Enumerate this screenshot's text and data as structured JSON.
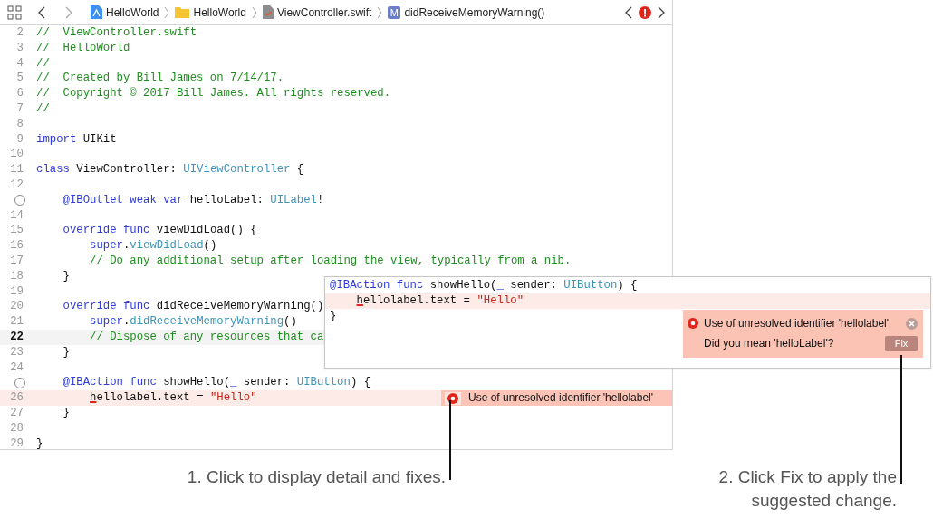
{
  "breadcrumbs": [
    {
      "kind": "app",
      "label": "HelloWorld"
    },
    {
      "kind": "folder",
      "label": "HelloWorld"
    },
    {
      "kind": "file",
      "label": "ViewController.swift"
    },
    {
      "kind": "method",
      "badge": "M",
      "label": "didReceiveMemoryWarning()"
    }
  ],
  "editor": {
    "lines": [
      {
        "number": "2",
        "connection": false,
        "current": false,
        "error": false,
        "code": [
          {
            "kind": "comment",
            "text": "//  ViewController.swift"
          }
        ]
      },
      {
        "number": "3",
        "connection": false,
        "current": false,
        "error": false,
        "code": [
          {
            "kind": "comment",
            "text": "//  HelloWorld"
          }
        ]
      },
      {
        "number": "4",
        "connection": false,
        "current": false,
        "error": false,
        "code": [
          {
            "kind": "comment",
            "text": "//"
          }
        ]
      },
      {
        "number": "5",
        "connection": false,
        "current": false,
        "error": false,
        "code": [
          {
            "kind": "comment",
            "text": "//  Created by Bill James on 7/14/17."
          }
        ]
      },
      {
        "number": "6",
        "connection": false,
        "current": false,
        "error": false,
        "code": [
          {
            "kind": "comment",
            "text": "//  Copyright © 2017 Bill James. All rights reserved."
          }
        ]
      },
      {
        "number": "7",
        "connection": false,
        "current": false,
        "error": false,
        "code": [
          {
            "kind": "comment",
            "text": "//"
          }
        ]
      },
      {
        "number": "8",
        "connection": false,
        "current": false,
        "error": false
      },
      {
        "number": "9",
        "connection": false,
        "current": false,
        "error": false,
        "code": [
          {
            "kind": "kw",
            "text": "import"
          },
          {
            "kind": "plain",
            "text": " UIKit"
          }
        ]
      },
      {
        "number": "10",
        "connection": false,
        "current": false,
        "error": false
      },
      {
        "number": "11",
        "connection": false,
        "current": false,
        "error": false,
        "code": [
          {
            "kind": "kw",
            "text": "class"
          },
          {
            "kind": "plain",
            "text": " ViewController: "
          },
          {
            "kind": "type",
            "text": "UIViewController"
          },
          {
            "kind": "plain",
            "text": " {"
          }
        ]
      },
      {
        "number": "12",
        "connection": false,
        "current": false,
        "error": false
      },
      {
        "connection": true,
        "current": false,
        "error": false,
        "code": [
          {
            "kind": "kw",
            "text": "    @IBOutlet weak var"
          },
          {
            "kind": "plain",
            "text": " helloLabel: "
          },
          {
            "kind": "type",
            "text": "UILabel"
          },
          {
            "kind": "plain",
            "text": "!"
          }
        ]
      },
      {
        "number": "14",
        "connection": false,
        "current": false,
        "error": false
      },
      {
        "number": "15",
        "connection": false,
        "current": false,
        "error": false,
        "code": [
          {
            "kind": "kw",
            "text": "    override func"
          },
          {
            "kind": "plain",
            "text": " viewDidLoad() {"
          }
        ]
      },
      {
        "number": "16",
        "connection": false,
        "current": false,
        "error": false,
        "code": [
          {
            "kind": "kw",
            "text": "        super"
          },
          {
            "kind": "plain",
            "text": "."
          },
          {
            "kind": "type",
            "text": "viewDidLoad"
          },
          {
            "kind": "plain",
            "text": "()"
          }
        ]
      },
      {
        "number": "17",
        "connection": false,
        "current": false,
        "error": false,
        "code": [
          {
            "kind": "comment",
            "text": "        // Do any additional setup after loading the view, typically from a nib."
          }
        ]
      },
      {
        "number": "18",
        "connection": false,
        "current": false,
        "error": false,
        "code": [
          {
            "kind": "plain",
            "text": "    }"
          }
        ]
      },
      {
        "number": "19",
        "connection": false,
        "current": false,
        "error": false
      },
      {
        "number": "20",
        "connection": false,
        "current": false,
        "error": false,
        "code": [
          {
            "kind": "kw",
            "text": "    override func"
          },
          {
            "kind": "plain",
            "text": " didReceiveMemoryWarning()"
          }
        ]
      },
      {
        "number": "21",
        "connection": false,
        "current": false,
        "error": false,
        "code": [
          {
            "kind": "kw",
            "text": "        super"
          },
          {
            "kind": "plain",
            "text": "."
          },
          {
            "kind": "type",
            "text": "didReceiveMemoryWarning"
          },
          {
            "kind": "plain",
            "text": "()"
          }
        ]
      },
      {
        "number": "22",
        "connection": false,
        "current": true,
        "error": false,
        "code": [
          {
            "kind": "comment",
            "text": "        // Dispose of any resources that ca"
          }
        ]
      },
      {
        "number": "23",
        "connection": false,
        "current": false,
        "error": false,
        "code": [
          {
            "kind": "plain",
            "text": "    }"
          }
        ]
      },
      {
        "number": "24",
        "connection": false,
        "current": false,
        "error": false
      },
      {
        "connection": true,
        "current": false,
        "error": false,
        "code": [
          {
            "kind": "kw",
            "text": "    @IBAction func"
          },
          {
            "kind": "plain",
            "text": " showHello("
          },
          {
            "kind": "kw",
            "text": "_"
          },
          {
            "kind": "plain",
            "text": " sender: "
          },
          {
            "kind": "type",
            "text": "UIButton"
          },
          {
            "kind": "plain",
            "text": ") {"
          }
        ]
      },
      {
        "number": "26",
        "connection": false,
        "current": false,
        "error": true,
        "code": [
          {
            "kind": "err",
            "text": "        h"
          },
          {
            "kind": "plain",
            "text": "ellolabel.text = "
          },
          {
            "kind": "str",
            "text": "\"Hello\""
          }
        ],
        "annotation": "Use of unresolved identifier 'hellolabel'"
      },
      {
        "number": "27",
        "connection": false,
        "current": false,
        "error": false,
        "code": [
          {
            "kind": "plain",
            "text": "    }"
          }
        ]
      },
      {
        "number": "28",
        "connection": false,
        "current": false,
        "error": false
      },
      {
        "number": "29",
        "connection": false,
        "current": false,
        "error": false,
        "code": [
          {
            "kind": "plain",
            "text": "}"
          }
        ]
      }
    ]
  },
  "popover": {
    "lines": [
      {
        "error": false,
        "code": [
          {
            "kind": "kw",
            "text": "@IBAction func"
          },
          {
            "kind": "plain",
            "text": " showHello("
          },
          {
            "kind": "kw",
            "text": "_"
          },
          {
            "kind": "plain",
            "text": " sender: "
          },
          {
            "kind": "type",
            "text": "UIButton"
          },
          {
            "kind": "plain",
            "text": ") {"
          }
        ]
      },
      {
        "error": true,
        "code": [
          {
            "kind": "err",
            "text": "    h"
          },
          {
            "kind": "plain",
            "text": "ellolabel.text = "
          },
          {
            "kind": "str",
            "text": "\"Hello\""
          }
        ]
      },
      {
        "error": false,
        "code": [
          {
            "kind": "plain",
            "text": "}"
          }
        ]
      }
    ],
    "issue": {
      "message": "Use of unresolved identifier 'hellolabel'",
      "suggestion": "Did you mean 'helloLabel'?",
      "fix_button": "Fix"
    }
  },
  "callouts": [
    {
      "text": "1. Click to display detail and fixes."
    },
    {
      "text": "2. Click Fix to apply the suggested change."
    }
  ]
}
